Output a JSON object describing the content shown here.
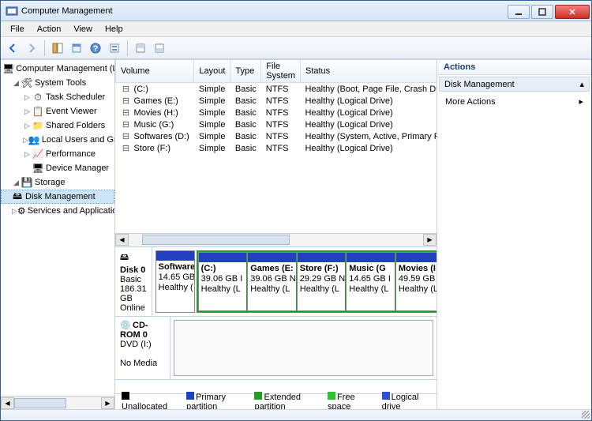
{
  "window": {
    "title": "Computer Management"
  },
  "menu": {
    "file": "File",
    "action": "Action",
    "view": "View",
    "help": "Help"
  },
  "tree": {
    "root": "Computer Management (Local",
    "systools": "System Tools",
    "tasksched": "Task Scheduler",
    "eventvwr": "Event Viewer",
    "shared": "Shared Folders",
    "localusers": "Local Users and Groups",
    "perf": "Performance",
    "devmgr": "Device Manager",
    "storage": "Storage",
    "diskmgmt": "Disk Management",
    "services": "Services and Applications"
  },
  "cols": {
    "volume": "Volume",
    "layout": "Layout",
    "type": "Type",
    "fs": "File System",
    "status": "Status"
  },
  "vols": [
    {
      "name": "(C:)",
      "layout": "Simple",
      "type": "Basic",
      "fs": "NTFS",
      "status": "Healthy (Boot, Page File, Crash Dump, Logical Drive)"
    },
    {
      "name": "Games (E:)",
      "layout": "Simple",
      "type": "Basic",
      "fs": "NTFS",
      "status": "Healthy (Logical Drive)"
    },
    {
      "name": "Movies (H:)",
      "layout": "Simple",
      "type": "Basic",
      "fs": "NTFS",
      "status": "Healthy (Logical Drive)"
    },
    {
      "name": "Music (G:)",
      "layout": "Simple",
      "type": "Basic",
      "fs": "NTFS",
      "status": "Healthy (Logical Drive)"
    },
    {
      "name": "Softwares (D:)",
      "layout": "Simple",
      "type": "Basic",
      "fs": "NTFS",
      "status": "Healthy (System, Active, Primary Partition)"
    },
    {
      "name": "Store (F:)",
      "layout": "Simple",
      "type": "Basic",
      "fs": "NTFS",
      "status": "Healthy (Logical Drive)"
    }
  ],
  "disk0": {
    "label": "Disk 0",
    "kind": "Basic",
    "size": "186.31 GB",
    "state": "Online",
    "primary": {
      "name": "Software",
      "size": "14.65 GB I",
      "status": "Healthy ("
    },
    "logical": [
      {
        "name": "(C:)",
        "size": "39.06 GB I",
        "status": "Healthy (L"
      },
      {
        "name": "Games (E:",
        "size": "39.06 GB N",
        "status": "Healthy (L"
      },
      {
        "name": "Store (F:)",
        "size": "29.29 GB N",
        "status": "Healthy (L"
      },
      {
        "name": "Music (G",
        "size": "14.65 GB I",
        "status": "Healthy (L"
      },
      {
        "name": "Movies (I",
        "size": "49.59 GB I",
        "status": "Healthy (L"
      }
    ]
  },
  "cdrom": {
    "label": "CD-ROM 0",
    "kind": "DVD (I:)",
    "state": "No Media"
  },
  "legend": {
    "unalloc": "Unallocated",
    "primary": "Primary partition",
    "extended": "Extended partition",
    "free": "Free space",
    "logical": "Logical drive"
  },
  "actions": {
    "header": "Actions",
    "section": "Disk Management",
    "more": "More Actions"
  }
}
